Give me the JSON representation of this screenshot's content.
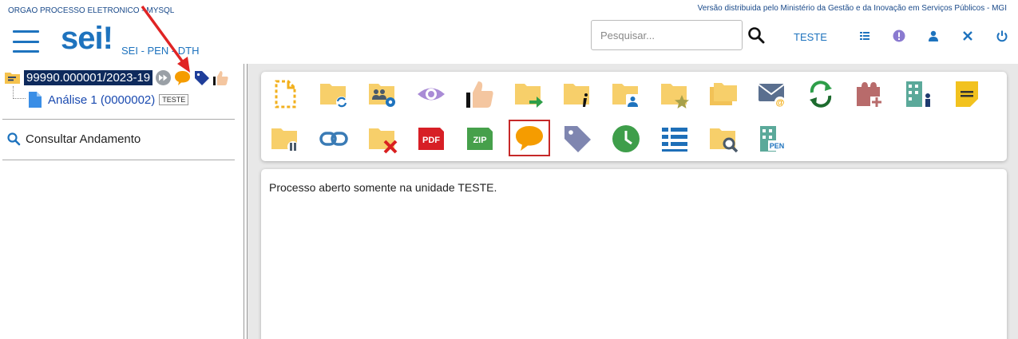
{
  "header": {
    "org_name": "ORGAO PROCESSO ELETRONICO - MYSQL",
    "gov_notice": "Versão distribuida pelo Ministério da Gestão e da Inovação em Serviços Públicos - MGI",
    "logo_text": "sei!",
    "system_label": "SEI - PEN - DTH",
    "search": {
      "placeholder": "Pesquisar..."
    },
    "unit": "TESTE",
    "icons": [
      "menu-icon",
      "search-icon",
      "grid-icon",
      "info-icon",
      "user-icon",
      "tools-icon",
      "power-icon"
    ],
    "accent_color": "#1e73be"
  },
  "tree": {
    "process_number": "99990.000001/2023-19",
    "process_icons": [
      "fast-forward-icon",
      "comment-icon",
      "tag-icon",
      "thumbs-up-icon"
    ],
    "document": {
      "label": "Análise 1 (0000002)",
      "unit_tag": "TESTE"
    },
    "consultar_andamento": "Consultar Andamento"
  },
  "toolbar": {
    "row1": [
      "new-document-icon",
      "folder-sync-icon",
      "folder-users-settings-icon",
      "eye-icon",
      "thumbs-up-icon",
      "folder-forward-icon",
      "folder-info-icon",
      "folder-user-icon",
      "folder-star-icon",
      "folders-icon",
      "email-icon",
      "refresh-icon",
      "relate-add-icon",
      "building-user-icon",
      "note-icon"
    ],
    "row2": [
      "folder-pause-icon",
      "link-icon",
      "folder-remove-icon",
      "pdf-icon",
      "zip-icon",
      "comment-icon",
      "tag-icon",
      "clock-icon",
      "list-icon",
      "folder-search-icon",
      "building-pen-icon"
    ],
    "pdf_text": "PDF",
    "zip_text": "ZIP",
    "pen_text": "PEN",
    "selected": "comment-icon",
    "highlight_color": "#c62828"
  },
  "content": {
    "message": "Processo aberto somente na unidade TESTE."
  }
}
